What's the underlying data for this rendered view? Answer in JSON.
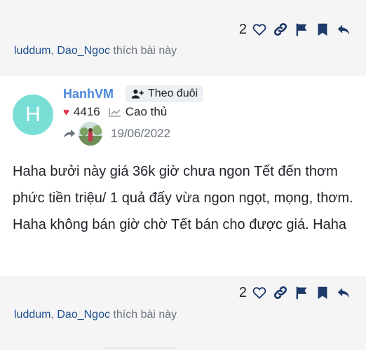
{
  "top_post": {
    "like_count": "2",
    "likers": [
      "luddum",
      "Dao_Ngoc"
    ],
    "likers_suffix": "thích bài này"
  },
  "post": {
    "author": {
      "initial": "H",
      "name": "HanhVM",
      "follow_label": "Theo đuôi",
      "points": "4416",
      "rank": "Cao thủ"
    },
    "date": "19/06/2022",
    "content": "Haha bưởi này giá 36k giờ chưa ngon Tết đến thơm phức tiền triệu/ 1 quả đấy vừa ngon ngọt, mọng, thơm. Haha không bán giờ chờ Tết bán cho được giá. Haha",
    "like_count": "2",
    "likers": [
      "luddum",
      "Dao_Ngoc"
    ],
    "likers_suffix": "thích bài này"
  },
  "colors": {
    "accent": "#4a89dc",
    "link": "#1d4f91",
    "heart": "#e0314b",
    "avatar_bg": "#79dfd6",
    "icon": "#1d3a6b"
  },
  "icons": [
    "heart-outline-icon",
    "link-icon",
    "flag-icon",
    "bookmark-icon",
    "reply-icon",
    "user-plus-icon",
    "heart-icon",
    "chart-line-icon",
    "share-icon"
  ]
}
